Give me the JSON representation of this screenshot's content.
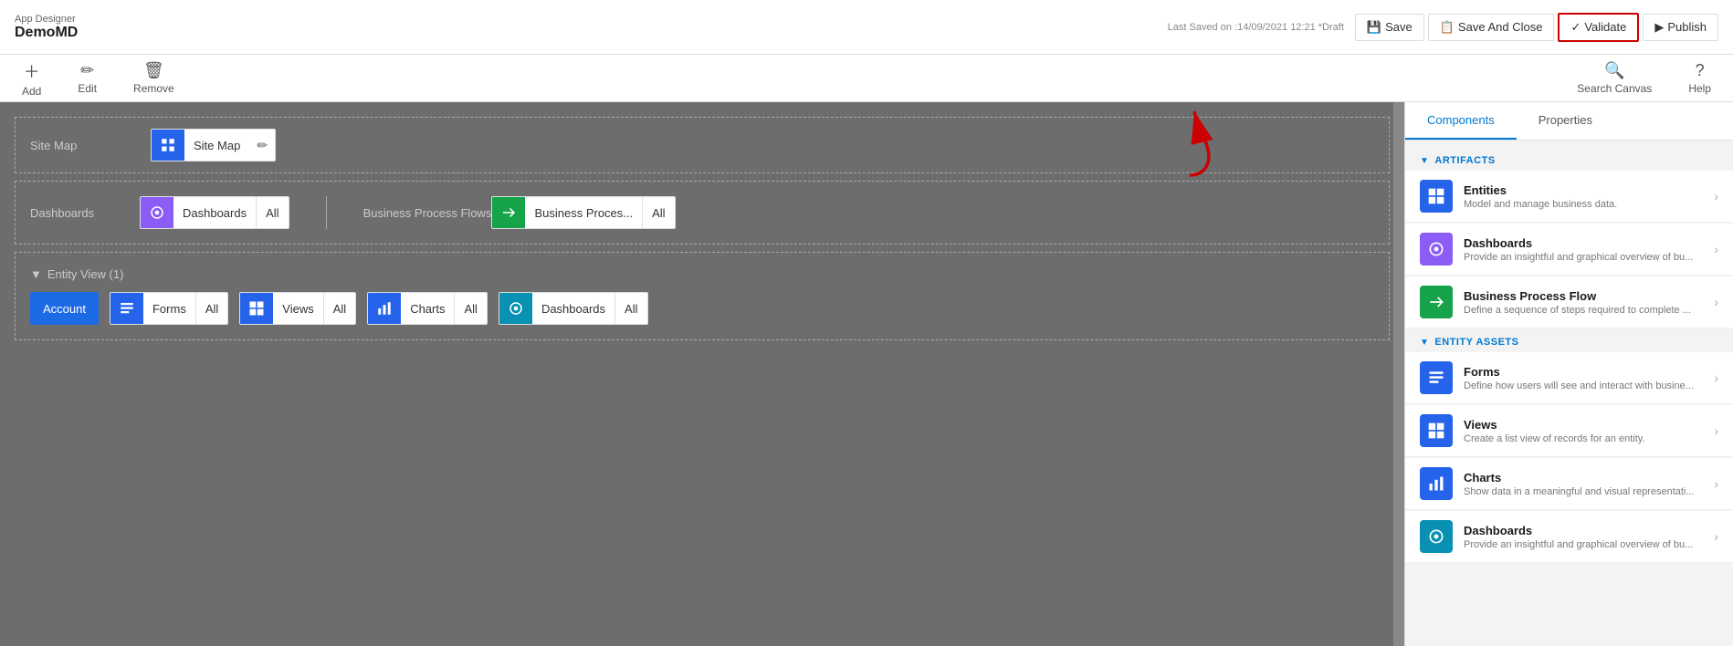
{
  "topbar": {
    "app_designer_label": "App Designer",
    "app_name": "DemoMD",
    "last_saved": "Last Saved on :14/09/2021 12:21 *Draft",
    "save_label": "Save",
    "save_and_close_label": "Save And Close",
    "validate_label": "Validate",
    "publish_label": "Publish"
  },
  "toolbar": {
    "add_label": "Add",
    "edit_label": "Edit",
    "remove_label": "Remove",
    "search_canvas_label": "Search Canvas",
    "help_label": "Help"
  },
  "canvas": {
    "site_map_label": "Site Map",
    "site_map_button": "Site Map",
    "dashboards_label": "Dashboards",
    "dashboards_button": "Dashboards",
    "dashboards_all": "All",
    "bpf_label": "Business Process Flows",
    "bpf_button": "Business Proces...",
    "bpf_all": "All",
    "entity_view_label": "Entity View (1)",
    "account_label": "Account",
    "forms_label": "Forms",
    "forms_all": "All",
    "views_label": "Views",
    "views_all": "All",
    "charts_label": "Charts",
    "charts_all": "All",
    "entity_dashboards_label": "Dashboards",
    "entity_dashboards_all": "All"
  },
  "right_panel": {
    "components_tab": "Components",
    "properties_tab": "Properties",
    "artifacts_header": "ARTIFACTS",
    "entity_assets_header": "ENTITY ASSETS",
    "items": [
      {
        "id": "entities",
        "icon_type": "blue",
        "icon": "⊞",
        "title": "Entities",
        "desc": "Model and manage business data."
      },
      {
        "id": "dashboards",
        "icon_type": "purple",
        "icon": "◎",
        "title": "Dashboards",
        "desc": "Provide an insightful and graphical overview of bu..."
      },
      {
        "id": "bpf",
        "icon_type": "green",
        "icon": "⇄",
        "title": "Business Process Flow",
        "desc": "Define a sequence of steps required to complete ..."
      }
    ],
    "entity_assets": [
      {
        "id": "forms",
        "icon_type": "blue",
        "icon": "☰",
        "title": "Forms",
        "desc": "Define how users will see and interact with busine..."
      },
      {
        "id": "views",
        "icon_type": "blue",
        "icon": "⊞",
        "title": "Views",
        "desc": "Create a list view of records for an entity."
      },
      {
        "id": "charts",
        "icon_type": "blue",
        "icon": "▦",
        "title": "Charts",
        "desc": "Show data in a meaningful and visual representati..."
      },
      {
        "id": "panel_dashboards",
        "icon_type": "teal",
        "icon": "◎",
        "title": "Dashboards",
        "desc": "Provide an insightful and graphical overview of bu..."
      }
    ]
  }
}
